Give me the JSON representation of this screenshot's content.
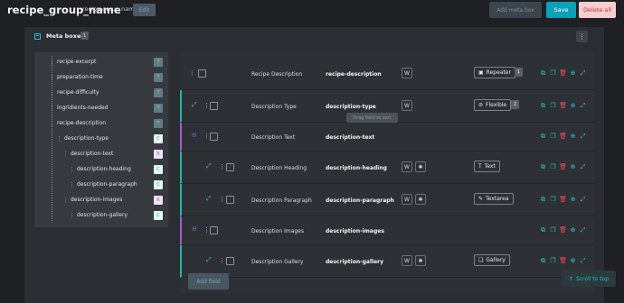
{
  "header": {
    "title": "recipe_group_name",
    "subtitle": "recipe group name",
    "edit_label": "Edit",
    "add_meta_box_label": "Add meta box",
    "save_label": "Save",
    "delete_all_label": "Delete all"
  },
  "panel": {
    "title": "Meta boxes",
    "count": "1",
    "menu_icon": "kebab-menu-icon"
  },
  "tree": {
    "items": [
      {
        "label": "recipe-excerpt",
        "badge": "T"
      },
      {
        "label": "preparation-time",
        "badge": "T"
      },
      {
        "label": "recipe-difficulty",
        "badge": "T"
      },
      {
        "label": "ingridients-needed",
        "badge": "T"
      },
      {
        "label": "recipe-description",
        "badge": "T"
      },
      {
        "label": "description-type",
        "badge": "C"
      },
      {
        "label": "description-text",
        "badge": "R"
      },
      {
        "label": "description-heading",
        "badge": "C"
      },
      {
        "label": "description-paragraph",
        "badge": "C"
      },
      {
        "label": "description-images",
        "badge": "R"
      },
      {
        "label": "description-gallery",
        "badge": "C"
      }
    ]
  },
  "fields": {
    "tooltip": "Drag field to sort",
    "rows": [
      {
        "label": "Recipe Description",
        "name": "recipe-description",
        "type": "Repeater",
        "count": "1"
      },
      {
        "label": "Description Type",
        "name": "description-type",
        "type": "Flexible",
        "count": "2"
      },
      {
        "label": "Description Text",
        "name": "description-text"
      },
      {
        "label": "Description Heading",
        "name": "description-heading",
        "type": "Text"
      },
      {
        "label": "Description Paragraph",
        "name": "description-paragraph",
        "type": "Textarea"
      },
      {
        "label": "Description Images",
        "name": "description-images"
      },
      {
        "label": "Description Gallery",
        "name": "description-gallery",
        "type": "Gallery"
      }
    ],
    "add_field_label": "Add field"
  },
  "scroll_top_label": "Scroll to top",
  "colors": {
    "accent": "#0ba1b6",
    "teal": "#2bc6c2",
    "danger": "#ee4b5c",
    "purple": "#9c5fd1"
  }
}
